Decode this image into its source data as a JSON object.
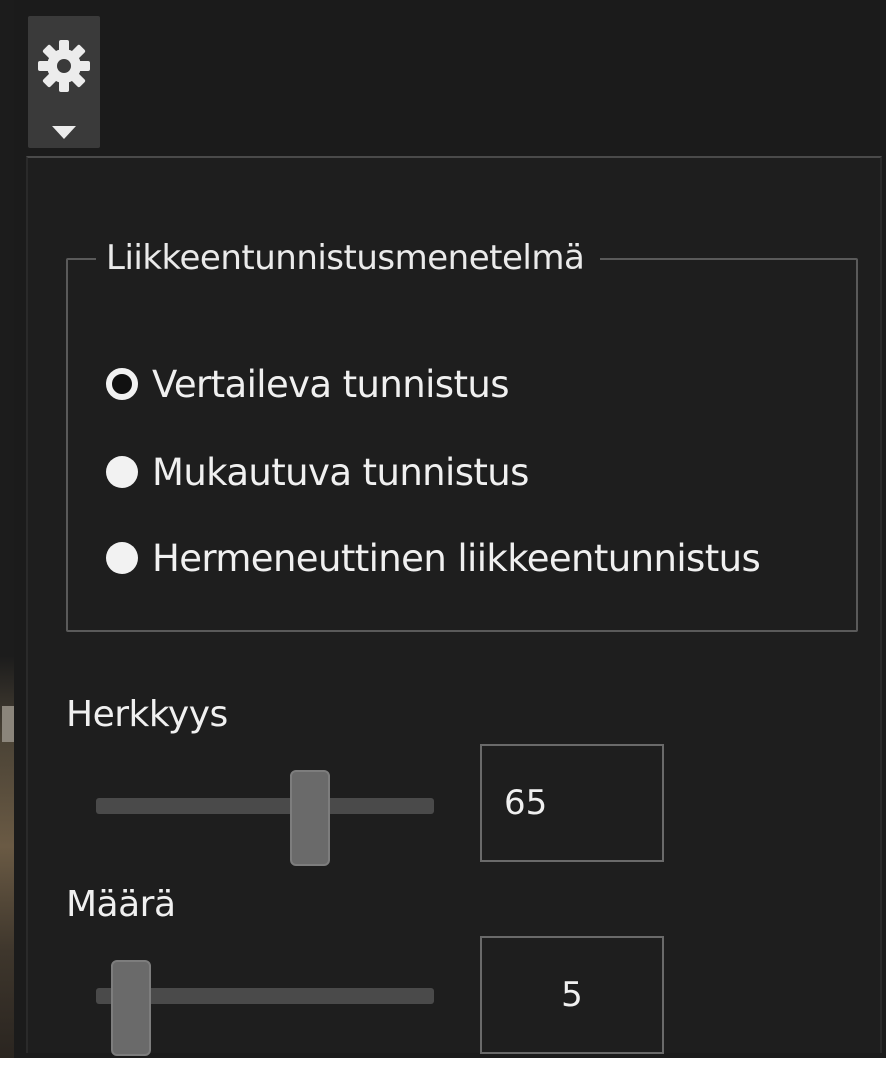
{
  "settings_button": {
    "icon": "gear-icon",
    "dropdown_icon": "caret-down-icon"
  },
  "motion_detection": {
    "group_title": "Liikkeentunnistusmenetelmä",
    "options": [
      {
        "label": "Vertaileva tunnistus",
        "selected": true
      },
      {
        "label": "Mukautuva tunnistus",
        "selected": false
      },
      {
        "label": "Hermeneuttinen liikkeentunnistus",
        "selected": false
      }
    ]
  },
  "sensitivity": {
    "label": "Herkkyys",
    "value": "65",
    "slider_fraction": 0.65
  },
  "amount": {
    "label": "Määrä",
    "value": "5",
    "slider_fraction": 0.05
  },
  "colors": {
    "background": "#1b1b1b",
    "panel": "#1e1e1e",
    "text": "#f0f0f0",
    "border": "#5a5a5a"
  }
}
